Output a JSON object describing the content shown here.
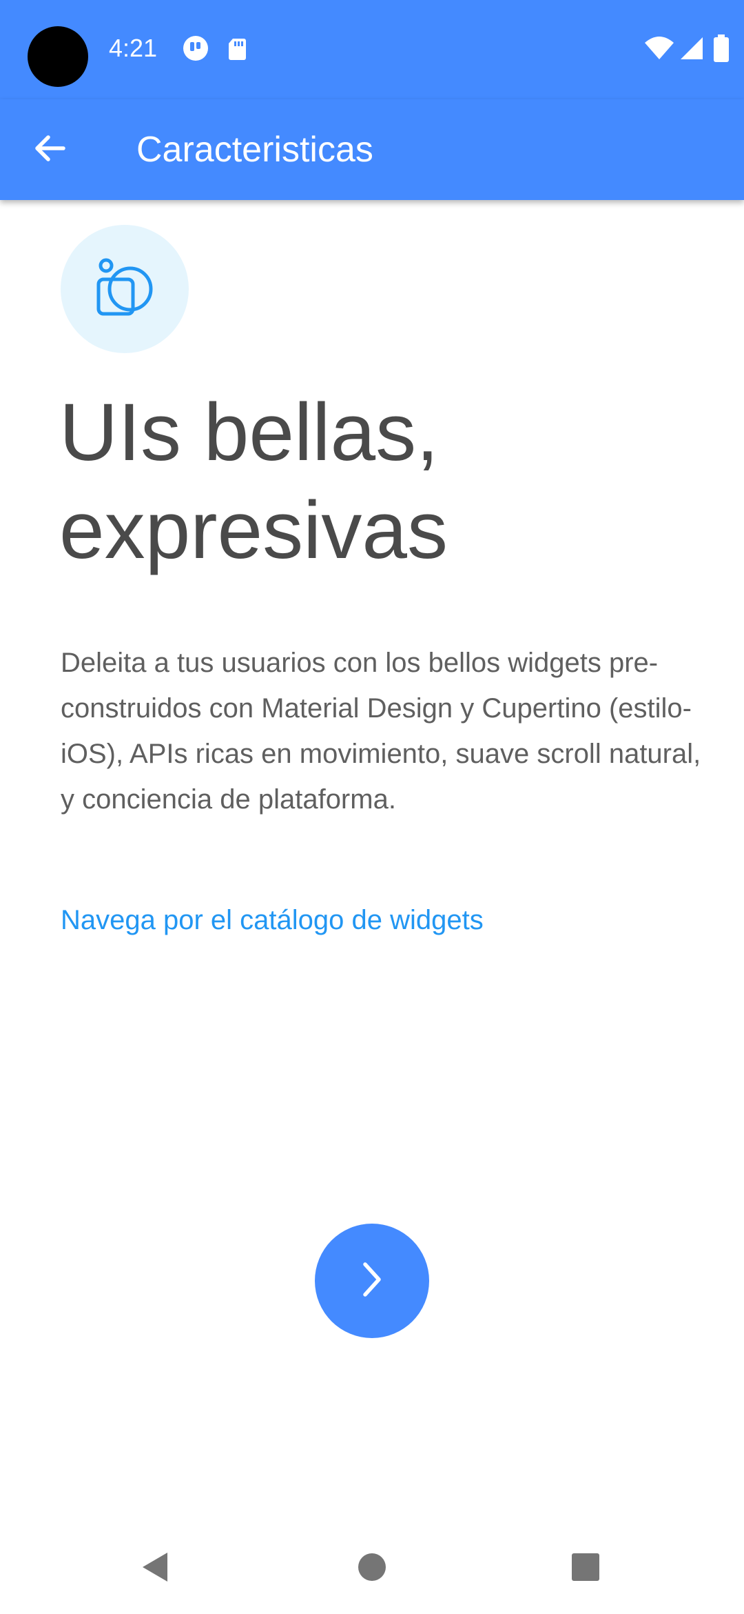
{
  "status_bar": {
    "time": "4:21",
    "background_color": "#448aff",
    "left_icons": [
      "notification-app-icon",
      "sd-card-icon"
    ],
    "right_icons": [
      "wifi-icon",
      "cellular-signal-icon",
      "battery-icon"
    ]
  },
  "app_bar": {
    "title": "Caracteristicas",
    "back_icon": "arrow-back-icon",
    "background_color": "#448aff"
  },
  "feature": {
    "icon": "shapes-icon",
    "headline": "UIs bellas, expresivas",
    "description": "Deleita a tus usuarios con los bellos widgets pre-construidos con Material Design y Cupertino (estilo-iOS), APIs ricas en movimiento, suave scroll natural, y conciencia de plataforma.",
    "link_text": "Navega por el catálogo de widgets",
    "link_color": "#2196f3"
  },
  "next_button": {
    "icon": "chevron-right-icon",
    "color": "#448aff"
  },
  "nav_bar": {
    "icons": [
      "nav-back-icon",
      "nav-home-icon",
      "nav-recents-icon"
    ]
  }
}
